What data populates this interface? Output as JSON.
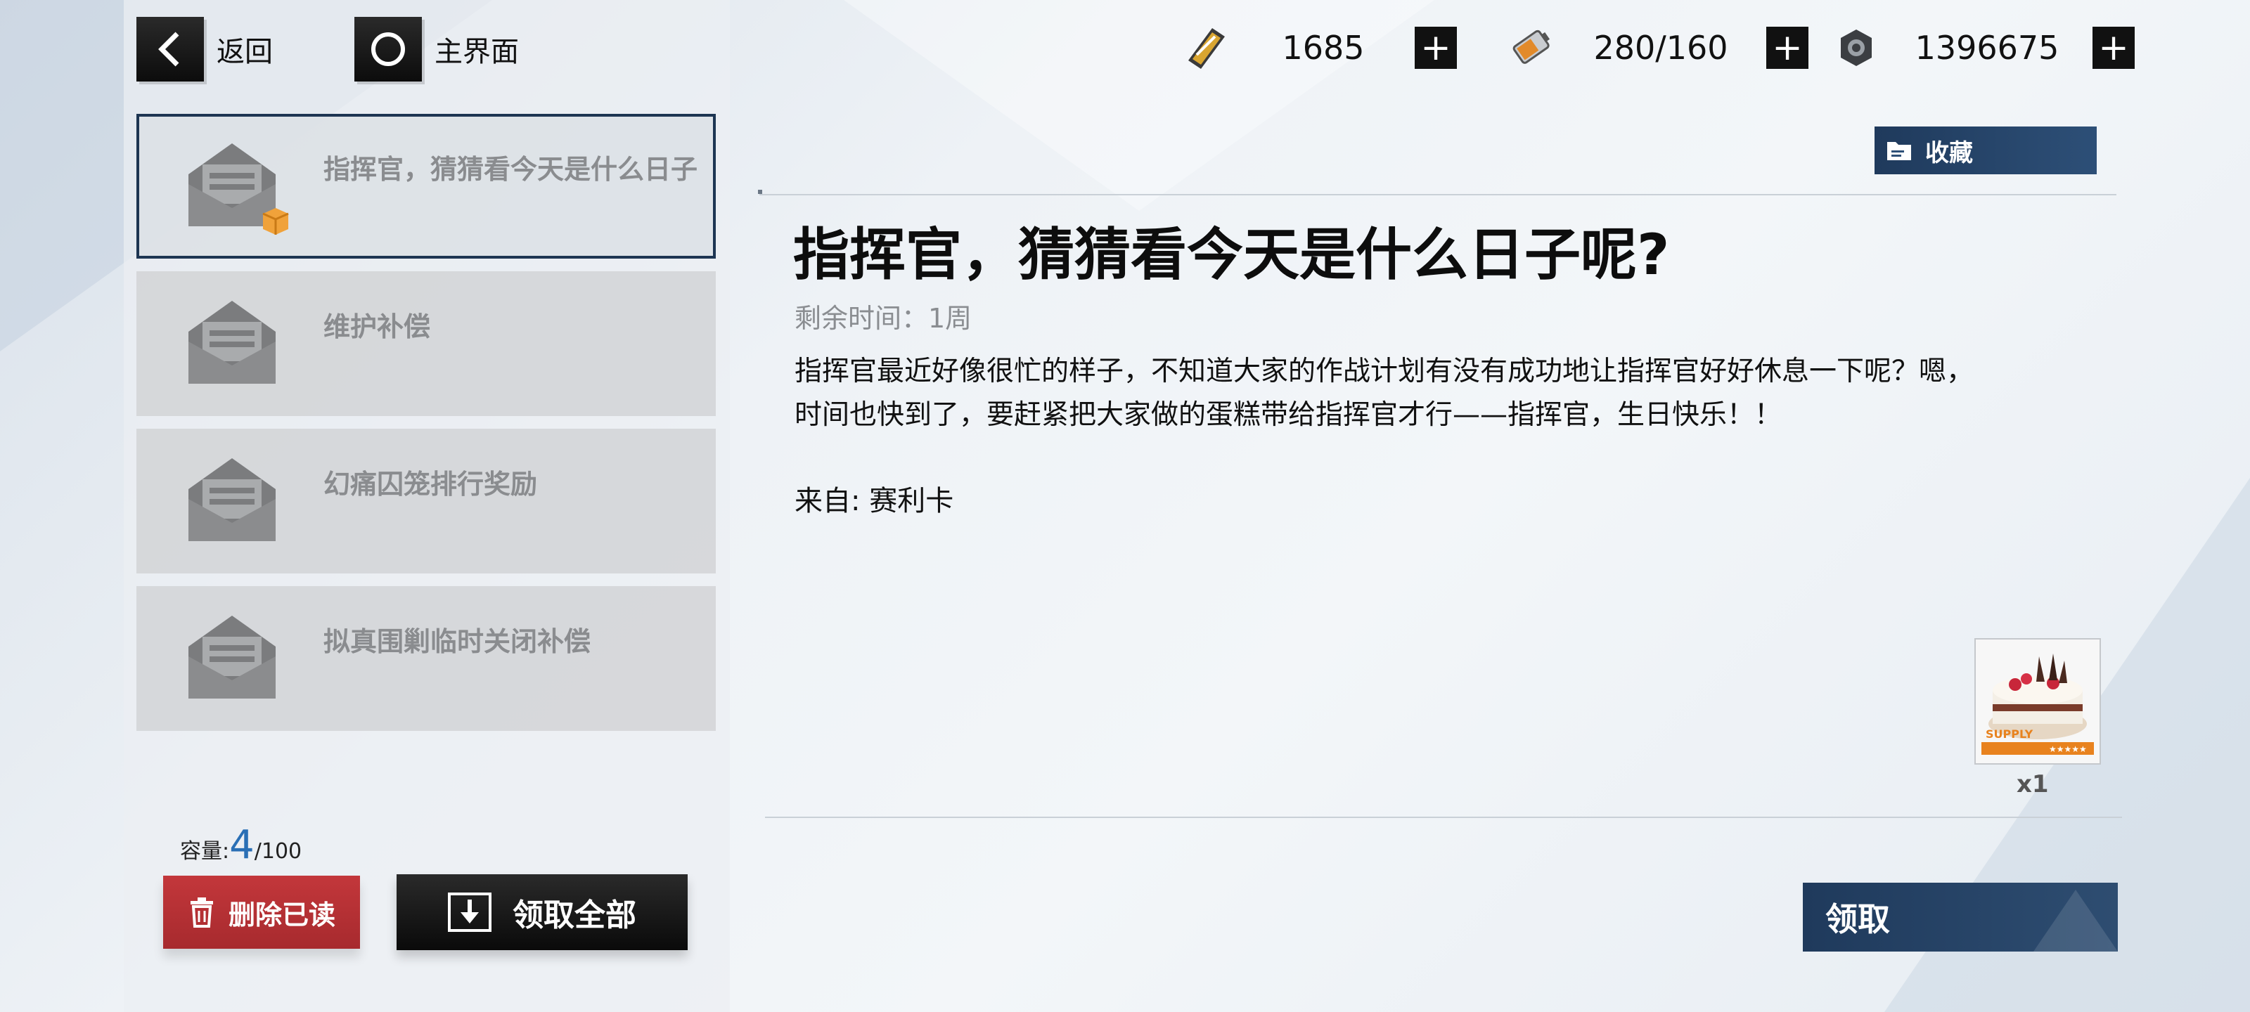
{
  "nav": {
    "back_label": "返回",
    "home_label": "主界面"
  },
  "resources": [
    {
      "icon": "ticket-icon",
      "value": "1685"
    },
    {
      "icon": "battery-icon",
      "value": "280/160"
    },
    {
      "icon": "gear-nut-icon",
      "value": "1396675"
    }
  ],
  "mail_list": [
    {
      "title": "指挥官，猜猜看今天是什么日子",
      "selected": true,
      "has_attachment": true
    },
    {
      "title": "维护补偿",
      "selected": false,
      "has_attachment": false
    },
    {
      "title": "幻痛囚笼排行奖励",
      "selected": false,
      "has_attachment": false
    },
    {
      "title": "拟真围剿临时关闭补偿",
      "selected": false,
      "has_attachment": false
    }
  ],
  "capacity": {
    "label": "容量:",
    "used": "4",
    "total": "/100"
  },
  "buttons": {
    "delete_read": "删除已读",
    "claim_all": "领取全部",
    "favorite": "收藏",
    "claim": "领取"
  },
  "mail_detail": {
    "title": "指挥官，猜猜看今天是什么日子呢?",
    "time_remaining": "剩余时间：1周",
    "body_line1": "指挥官最近好像很忙的样子，不知道大家的作战计划有没有成功地让指挥官好好休息一下呢？嗯，",
    "body_line2": "时间也快到了，要赶紧把大家做的蛋糕带给指挥官才行——指挥官，生日快乐！！",
    "from": "来自: 赛利卡",
    "attachment": {
      "icon": "cake-icon",
      "tag": "SUPPLY",
      "count": "x1"
    }
  },
  "colors": {
    "accent_navy": "#1f3a5c",
    "delete_red": "#b3302f",
    "capacity_blue": "#2a6fb5"
  }
}
